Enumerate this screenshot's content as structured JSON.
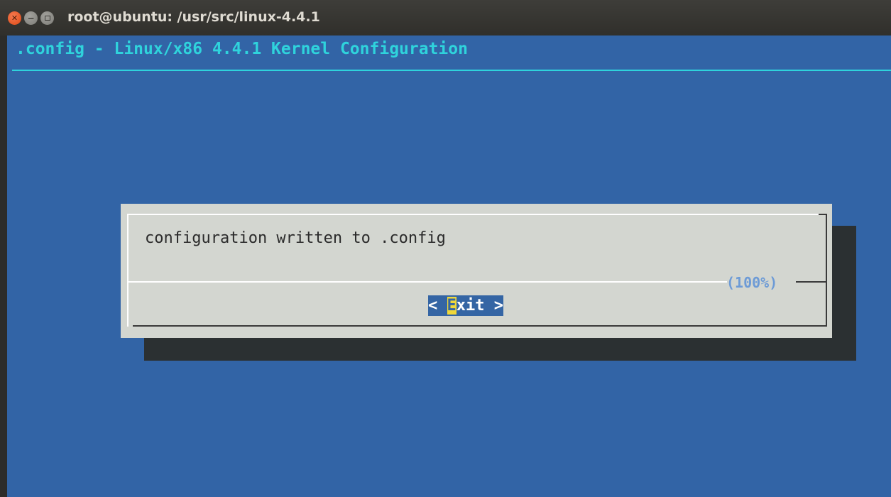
{
  "window": {
    "title": "root@ubuntu: /usr/src/linux-4.4.1",
    "buttons": {
      "close_icon": "close-icon",
      "minimize_icon": "minimize-icon",
      "maximize_icon": "maximize-icon"
    }
  },
  "terminal": {
    "backtitle": ".config - Linux/x86 4.4.1 Kernel Configuration",
    "background_color": "#3264a6",
    "backtitle_color": "#2fd3dc"
  },
  "dialog": {
    "message": "configuration written to .config",
    "progress_label": "(100%)",
    "exit_button": {
      "left_bracket": "< ",
      "hotkey": "E",
      "rest": "xit",
      "right_bracket": " >"
    },
    "button_color": "#3465a4",
    "hotkey_color": "#f0d83a"
  }
}
